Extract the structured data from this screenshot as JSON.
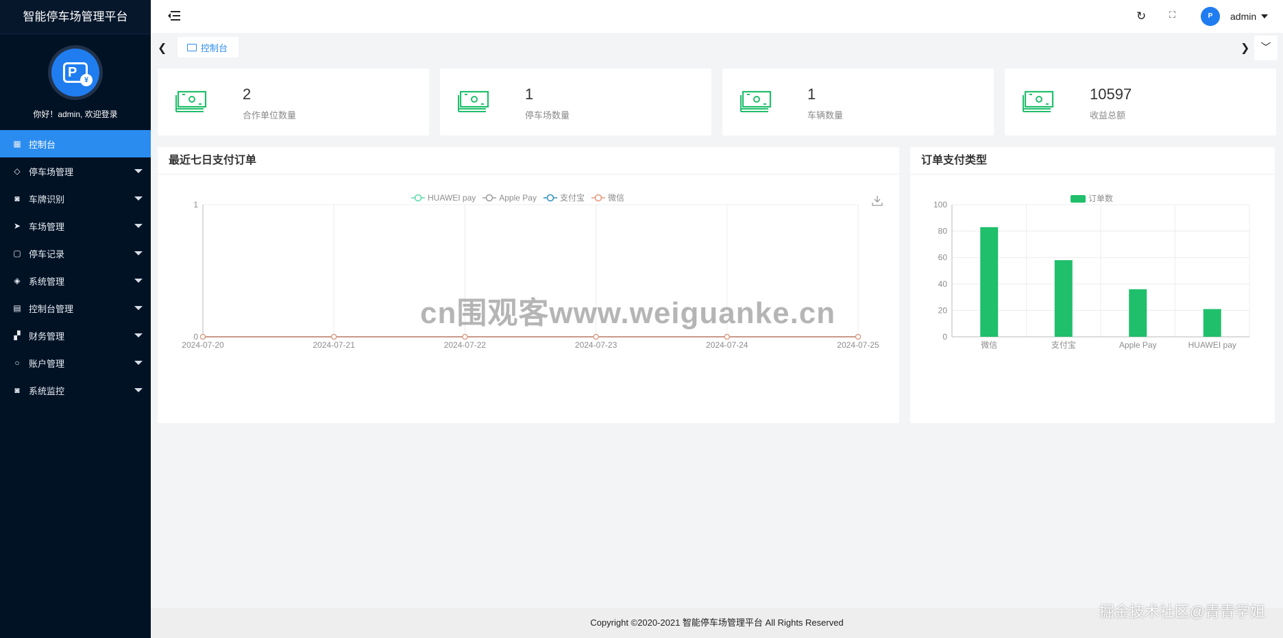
{
  "app": {
    "title": "智能停车场管理平台",
    "welcome": "你好！admin, 欢迎登录"
  },
  "sidebar": {
    "items": [
      {
        "label": "控制台",
        "icon": "dashboard-icon",
        "active": true
      },
      {
        "label": "停车场管理",
        "icon": "diamond-icon"
      },
      {
        "label": "车牌识别",
        "icon": "camera-icon"
      },
      {
        "label": "车场管理",
        "icon": "send-icon"
      },
      {
        "label": "停车记录",
        "icon": "note-icon"
      },
      {
        "label": "系统管理",
        "icon": "layers-icon"
      },
      {
        "label": "控制台管理",
        "icon": "clipboard-icon"
      },
      {
        "label": "财务管理",
        "icon": "grid-icon"
      },
      {
        "label": "账户管理",
        "icon": "user-icon"
      },
      {
        "label": "系统监控",
        "icon": "camera-icon"
      }
    ]
  },
  "header": {
    "username": "admin"
  },
  "tabs": [
    {
      "label": "控制台",
      "active": true
    }
  ],
  "stats": [
    {
      "value": "2",
      "label": "合作单位数量"
    },
    {
      "value": "1",
      "label": "停车场数量"
    },
    {
      "value": "1",
      "label": "车辆数量"
    },
    {
      "value": "10597",
      "label": "收益总额"
    }
  ],
  "line_panel": {
    "title": "最近七日支付订单"
  },
  "bar_panel": {
    "title": "订单支付类型"
  },
  "chart_data": [
    {
      "type": "line",
      "x": [
        "2024-07-20",
        "2024-07-21",
        "2024-07-22",
        "2024-07-23",
        "2024-07-24",
        "2024-07-25"
      ],
      "yticks": [
        "0",
        "1"
      ],
      "ylim": [
        0,
        1
      ],
      "series": [
        {
          "name": "HUAWEI pay",
          "values": [
            0,
            0,
            0,
            0,
            0,
            0
          ],
          "color": "#5ad8a6"
        },
        {
          "name": "Apple Pay",
          "values": [
            0,
            0,
            0,
            0,
            0,
            0
          ],
          "color": "#9a9a9a"
        },
        {
          "name": "支付宝",
          "values": [
            0,
            0,
            0,
            0,
            0,
            0
          ],
          "color": "#2f8fbd"
        },
        {
          "name": "微信",
          "values": [
            0,
            0,
            0,
            0,
            0,
            0
          ],
          "color": "#e8967a"
        }
      ],
      "grid": true,
      "legend": "top-center"
    },
    {
      "type": "bar",
      "categories": [
        "微信",
        "支付宝",
        "Apple Pay",
        "HUAWEI pay"
      ],
      "series": [
        {
          "name": "订单数",
          "values": [
            83,
            58,
            36,
            21
          ],
          "color": "#20bf6b"
        }
      ],
      "yticks": [
        "0",
        "20",
        "40",
        "60",
        "80",
        "100"
      ],
      "ylim": [
        0,
        100
      ],
      "grid": true,
      "legend": "top-center"
    }
  ],
  "watermark": "cn围观客www.weiguanke.cn",
  "footer": {
    "text": "Copyright ©2020-2021 智能停车场管理平台 All Rights Reserved"
  },
  "corner_mark": "掘金技术社区@青青学姐"
}
